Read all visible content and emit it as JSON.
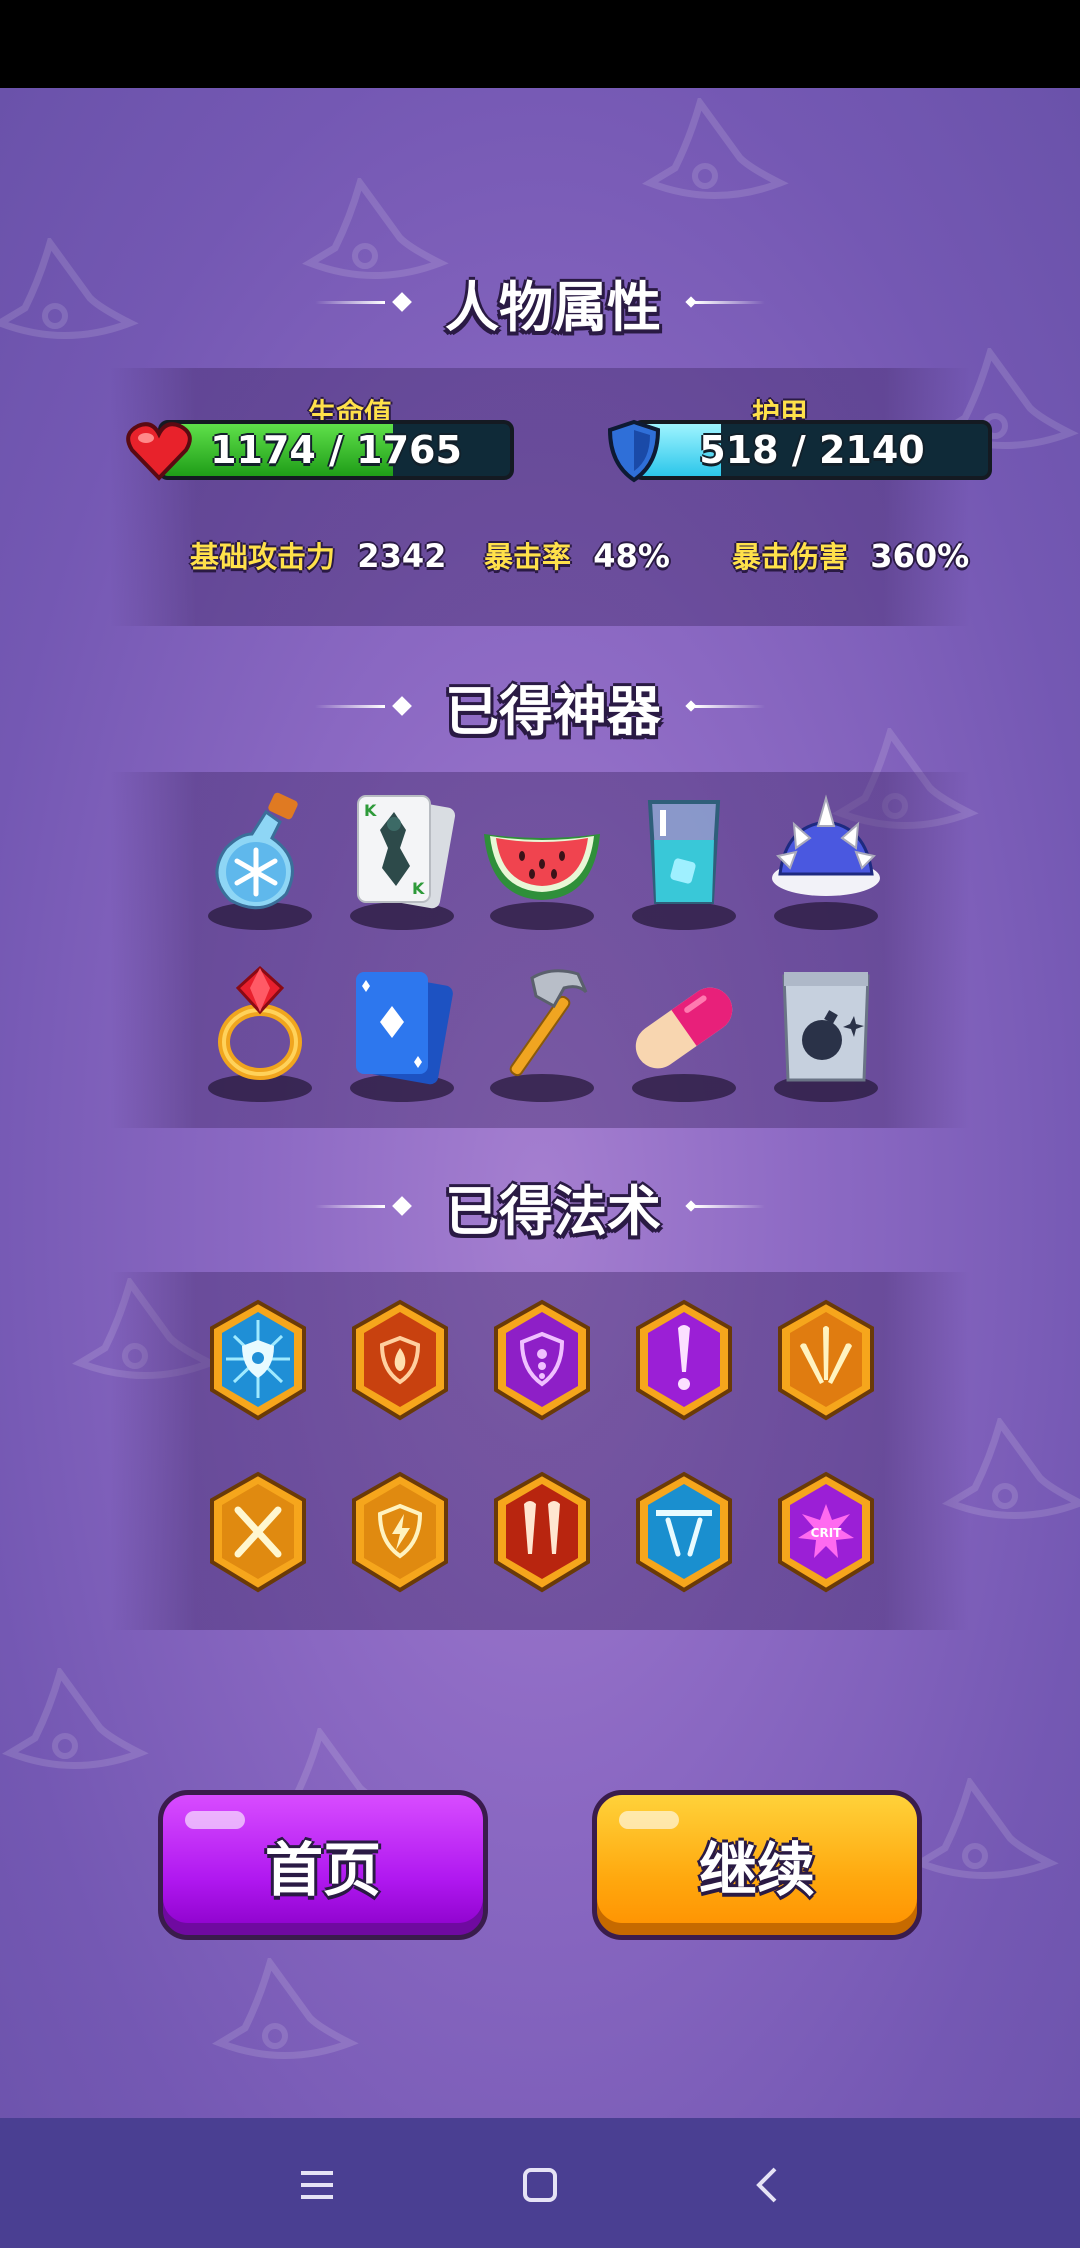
{
  "sections": {
    "attributes_title": "人物属性",
    "artifacts_title": "已得神器",
    "spells_title": "已得法术"
  },
  "stats": {
    "hp": {
      "label": "生命值",
      "current": 1174,
      "max": 1765,
      "text": "1174 / 1765",
      "color": "#35c52a"
    },
    "armor": {
      "label": "护甲",
      "current": 518,
      "max": 2140,
      "text": "518 / 2140",
      "color": "#4fe0ff"
    },
    "attack": {
      "label": "基础攻击力",
      "value": "2342"
    },
    "crit_rate": {
      "label": "暴击率",
      "value": "48%"
    },
    "crit_damage": {
      "label": "暴击伤害",
      "value": "360%"
    }
  },
  "artifacts": [
    "snowflake-potion-icon",
    "king-of-clubs-cards-icon",
    "watermelon-slice-icon",
    "ice-water-glass-icon",
    "spiked-shell-icon",
    "ruby-ring-icon",
    "diamond-cards-icon",
    "hammer-icon",
    "pill-capsule-icon",
    "bomb-bag-icon"
  ],
  "spells": [
    {
      "icon": "ice-shield-icon",
      "color": "#1f8fd6"
    },
    {
      "icon": "fire-shield-icon",
      "color": "#c8410f"
    },
    {
      "icon": "arcane-shield-icon",
      "color": "#8e1fc7"
    },
    {
      "icon": "magic-bolt-icon",
      "color": "#9b1fd6"
    },
    {
      "icon": "triple-shot-icon",
      "color": "#e07c10"
    },
    {
      "icon": "crossed-swords-icon",
      "color": "#e08a10"
    },
    {
      "icon": "lightning-shield-icon",
      "color": "#e08a10"
    },
    {
      "icon": "double-fang-icon",
      "color": "#b8250f"
    },
    {
      "icon": "ricochet-icon",
      "color": "#1a8fcf"
    },
    {
      "icon": "crit-burst-icon",
      "color": "#9b1fd6",
      "text": "CRIT"
    }
  ],
  "buttons": {
    "home": "首页",
    "continue": "继续"
  },
  "navbar": [
    "menu-icon",
    "home-square-icon",
    "back-icon"
  ]
}
